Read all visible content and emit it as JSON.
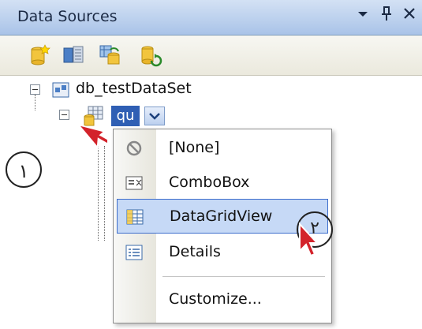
{
  "panel": {
    "title": "Data Sources",
    "controls": {
      "dropdown_icon": "chevron-down-icon",
      "pin_icon": "pin-icon",
      "close_icon": "close-icon"
    }
  },
  "toolbar": {
    "icons": [
      "add-data-source-icon",
      "edit-dataset-designer-icon",
      "configure-dataset-icon",
      "refresh-icon"
    ]
  },
  "tree": {
    "root_label": "db_testDataSet",
    "selected_node_label": "qu"
  },
  "dropdown_menu": {
    "items": [
      {
        "label": "[None]",
        "icon": "none-icon"
      },
      {
        "label": "ComboBox",
        "icon": "combobox-icon"
      },
      {
        "label": "DataGridView",
        "icon": "datagridview-icon",
        "highlighted": true
      },
      {
        "label": "Details",
        "icon": "details-icon"
      },
      {
        "label": "Customize...",
        "icon": ""
      }
    ]
  },
  "annotations": {
    "callout_1": "١",
    "callout_2": "٢"
  },
  "colors": {
    "selection": "#2f5fb4",
    "highlight": "#c6d9f6",
    "cursor": "#d3232b"
  }
}
